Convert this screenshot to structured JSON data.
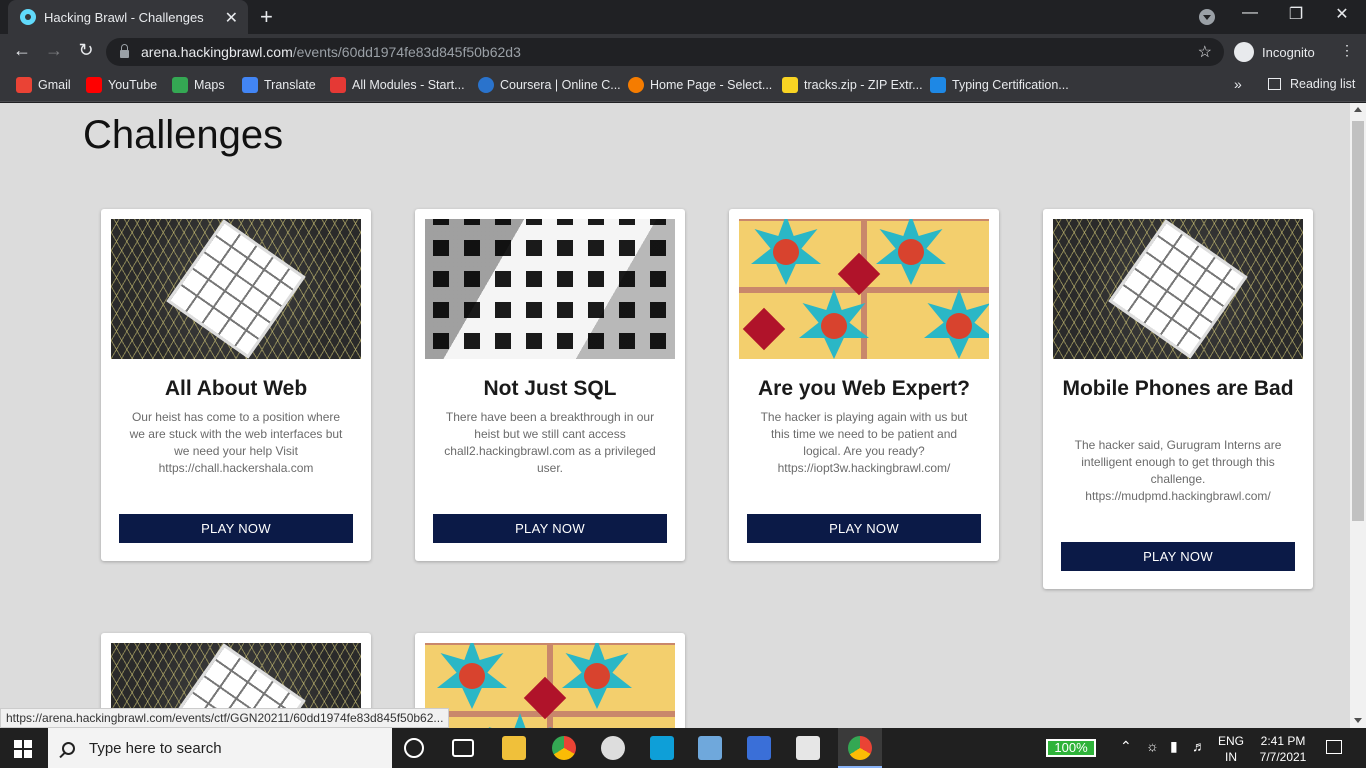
{
  "browser": {
    "tab_title": "Hacking Brawl - Challenges",
    "tab_close": "✕",
    "new_tab": "+",
    "url_host": "arena.hackingbrawl.com",
    "url_path": "/events/60dd1974fe83d845f50b62d3",
    "profile_label": "Incognito",
    "bookmarks": [
      {
        "label": "Gmail",
        "color": "#ea4335"
      },
      {
        "label": "YouTube",
        "color": "#ff0000"
      },
      {
        "label": "Maps",
        "color": "#34a853"
      },
      {
        "label": "Translate",
        "color": "#4285f4"
      },
      {
        "label": "All Modules - Start...",
        "color": "#e53935"
      },
      {
        "label": "Coursera | Online C...",
        "color": "#2a73cc"
      },
      {
        "label": "Home Page - Select...",
        "color": "#f57c00"
      },
      {
        "label": "tracks.zip - ZIP Extr...",
        "color": "#f9d423"
      },
      {
        "label": "Typing Certification...",
        "color": "#1e88e5"
      }
    ],
    "bookmarks_more": "»",
    "reading_list": "Reading list",
    "status_url": "https://arena.hackingbrawl.com/events/ctf/GGN20211/60dd1974fe83d845f50b62..."
  },
  "page": {
    "title": "Challenges",
    "cards": [
      {
        "title": "All About Web",
        "description": "Our heist has come to a position where we are stuck with the web interfaces but we need your help Visit https://chall.hackershala.com",
        "button": "PLAY NOW"
      },
      {
        "title": "Not Just SQL",
        "description": "There have been a breakthrough in our heist but we still cant access chall2.hackingbrawl.com as a privileged user.",
        "button": "PLAY NOW"
      },
      {
        "title": "Are you Web Expert?",
        "description": "The hacker is playing again with us but this time we need to be patient and logical. Are you ready? https://iopt3w.hackingbrawl.com/",
        "button": "PLAY NOW"
      },
      {
        "title": "Mobile Phones are Bad",
        "description": "The hacker said, Gurugram Interns are intelligent enough to get through this challenge. https://mudpmd.hackingbrawl.com/",
        "button": "PLAY NOW"
      }
    ]
  },
  "taskbar": {
    "search_placeholder": "Type here to search",
    "battery": "100%",
    "lang_top": "ENG",
    "lang_bottom": "IN",
    "time": "2:41 PM",
    "date": "7/7/2021"
  }
}
